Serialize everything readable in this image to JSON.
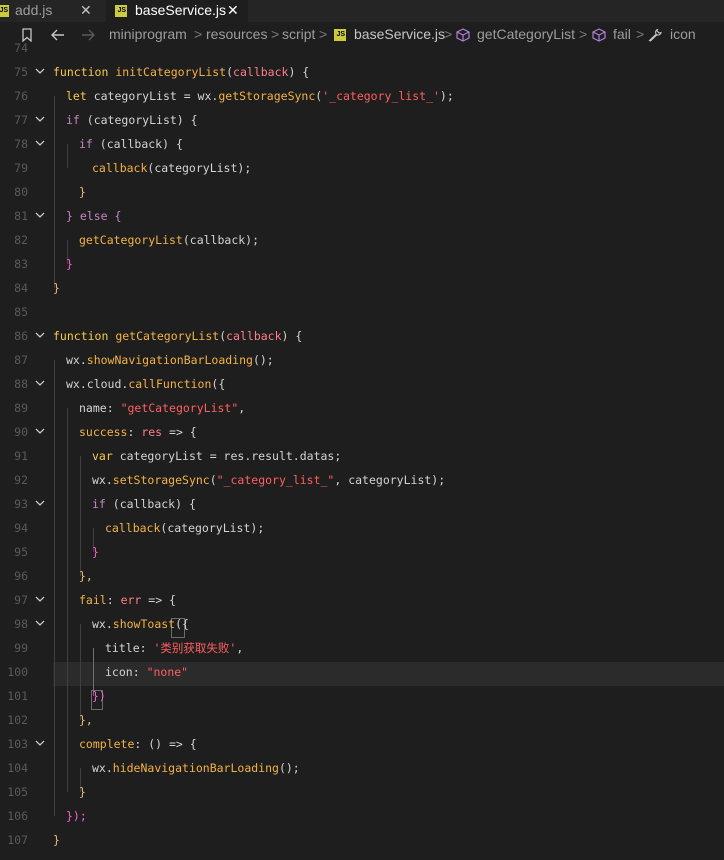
{
  "tabs": [
    {
      "label": "add.js",
      "icon": "js-file-icon",
      "active": false
    },
    {
      "label": "baseService.js",
      "icon": "js-file-icon",
      "active": true
    }
  ],
  "tab_close_glyph": "✕",
  "breadcrumb": {
    "items": [
      "miniprogram",
      "resources",
      "script",
      "baseService.js",
      "getCategoryList",
      "fail",
      "icon"
    ],
    "separator": ">"
  },
  "line_numbers": [
    "74",
    "75",
    "76",
    "77",
    "78",
    "79",
    "80",
    "81",
    "82",
    "83",
    "84",
    "85",
    "86",
    "87",
    "88",
    "89",
    "90",
    "91",
    "92",
    "93",
    "94",
    "95",
    "96",
    "97",
    "98",
    "99",
    "100",
    "101",
    "102",
    "103",
    "104",
    "105",
    "106",
    "107"
  ],
  "code": {
    "l75": {
      "kw": "function",
      "name": "initCategoryList",
      "param": "callback",
      "open": " {"
    },
    "l76": {
      "kw": "let",
      "rest": " categoryList = wx.",
      "call": "getStorageSync",
      "arg": "'_category_list_'",
      "end": ");"
    },
    "l77": {
      "kw": "if",
      "rest": " (categoryList) {"
    },
    "l78": {
      "kw": "if",
      "rest": " (callback) {"
    },
    "l79": {
      "call": "callback",
      "rest": "(categoryList);"
    },
    "l80": {
      "rest": "}"
    },
    "l81": {
      "rest": "} else {"
    },
    "l82": {
      "call": "getCategoryList",
      "rest": "(callback);"
    },
    "l83": {
      "rest": "}"
    },
    "l84": {
      "rest": "}"
    },
    "l86": {
      "kw": "function",
      "name": "getCategoryList",
      "param": "callback",
      "open": " {"
    },
    "l87": {
      "pre": "wx.",
      "call": "showNavigationBarLoading",
      "rest": "();"
    },
    "l88": {
      "pre": "wx.cloud.",
      "call": "callFunction",
      "rest": "({"
    },
    "l89": {
      "key": "name",
      "rest": ": ",
      "str": "\"getCategoryList\"",
      "end": ","
    },
    "l90": {
      "key": "success",
      "rest": ": ",
      "param": "res",
      "arrow": " => {"
    },
    "l91": {
      "kw": "var",
      "rest": " categoryList = res.result.datas;"
    },
    "l92": {
      "pre": "wx.",
      "call": "setStorageSync",
      "str": "\"_category_list_\"",
      "rest": ", categoryList);"
    },
    "l93": {
      "kw": "if",
      "rest": " (callback) {"
    },
    "l94": {
      "call": "callback",
      "rest": "(categoryList);"
    },
    "l95": {
      "rest": "}"
    },
    "l96": {
      "rest": "},"
    },
    "l97": {
      "key": "fail",
      "rest": ": ",
      "param": "err",
      "arrow": " => {"
    },
    "l98": {
      "pre": "wx.",
      "call": "showToast",
      "rest": "({"
    },
    "l99": {
      "key": "title",
      "rest": ": ",
      "str": "'类别获取失败'",
      "end": ","
    },
    "l100": {
      "key": "icon",
      "rest": ": ",
      "str": "\"none\""
    },
    "l101": {
      "rest": "})"
    },
    "l102": {
      "rest": "},"
    },
    "l103": {
      "key": "complete",
      "rest": ": () => {"
    },
    "l104": {
      "pre": "wx.",
      "call": "hideNavigationBarLoading",
      "rest": "();"
    },
    "l105": {
      "rest": "}"
    },
    "l106": {
      "rest": "});"
    },
    "l107": {
      "rest": "}"
    }
  },
  "colors": {
    "background": "#1e1e1e",
    "keyword": "#c586c0",
    "function": "#f3b247",
    "string": "#ff5f5f",
    "js_badge": "#cbcb41"
  }
}
